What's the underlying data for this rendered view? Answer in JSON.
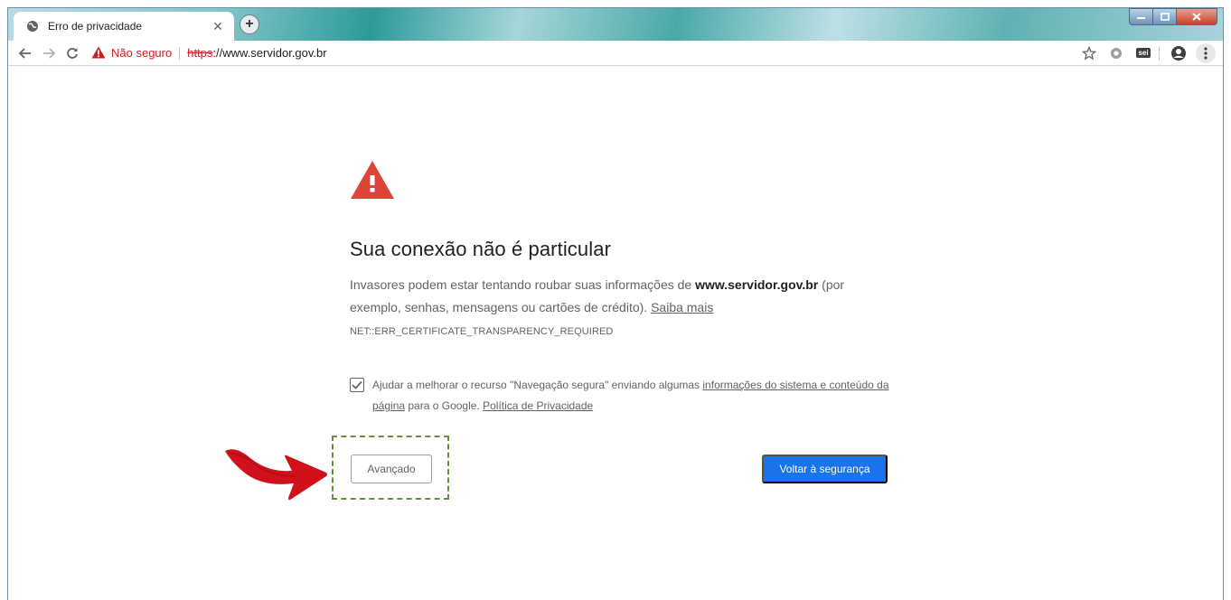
{
  "tab": {
    "title": "Erro de privacidade",
    "close_icon": "✕",
    "new_tab_icon": "+"
  },
  "toolbar": {
    "security_label": "Não seguro",
    "url_scheme": "https",
    "url_rest": "://www.servidor.gov.br",
    "extension_label": "sei"
  },
  "page": {
    "heading": "Sua conexão não é particular",
    "desc_before": "Invasores podem estar tentando roubar suas informações de ",
    "desc_domain": "www.servidor.gov.br",
    "desc_after": " (por exemplo, senhas, mensagens ou cartões de crédito). ",
    "learn_more": "Saiba mais",
    "error_code": "NET::ERR_CERTIFICATE_TRANSPARENCY_REQUIRED",
    "optin_before": "Ajudar a melhorar o recurso \"Navegação segura\" enviando algumas ",
    "optin_link1": "informações do sistema e conteúdo da página",
    "optin_middle": " para o Google. ",
    "optin_link2": "Política de Privacidade",
    "optin_checked": true,
    "advanced_button": "Avançado",
    "back_button": "Voltar à segurança"
  },
  "colors": {
    "warning_red": "#db4437",
    "primary_blue": "#1a73e8",
    "not_secure_red": "#c5221f",
    "highlight_green": "#6a8e3a",
    "annotation_red": "#d0111b"
  }
}
